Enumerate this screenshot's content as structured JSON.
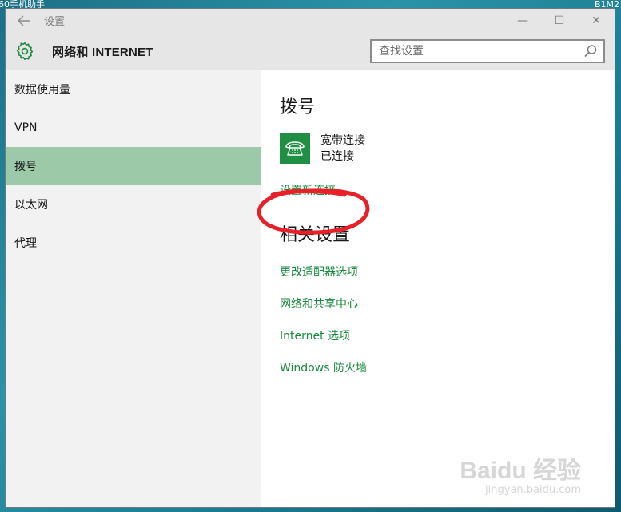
{
  "desktop": {
    "top_left_text": "60手机助手",
    "top_right_text": "B1M2"
  },
  "window": {
    "title": "设置",
    "controls": {
      "minimize": "—",
      "maximize": "☐",
      "close": "✕"
    }
  },
  "header": {
    "title": "网络和 INTERNET",
    "search_placeholder": "查找设置"
  },
  "sidebar": {
    "items": [
      {
        "label": "数据使用量"
      },
      {
        "label": "VPN"
      },
      {
        "label": "拨号"
      },
      {
        "label": "以太网"
      },
      {
        "label": "代理"
      }
    ]
  },
  "main": {
    "heading": "拨号",
    "connection": {
      "name": "宽带连接",
      "status": "已连接"
    },
    "setup_link": "设置新连接",
    "related_heading": "相关设置",
    "related_links": [
      {
        "label": "更改适配器选项"
      },
      {
        "label": "网络和共享中心"
      },
      {
        "label": "Internet 选项"
      },
      {
        "label": "Windows 防火墙"
      }
    ]
  },
  "watermark": {
    "brand": "Baidu 经验",
    "url": "jingyan.baidu.com"
  },
  "colors": {
    "accent": "#178a3c",
    "active_bg": "#9ccaa8",
    "annotation": "#e8202a"
  }
}
